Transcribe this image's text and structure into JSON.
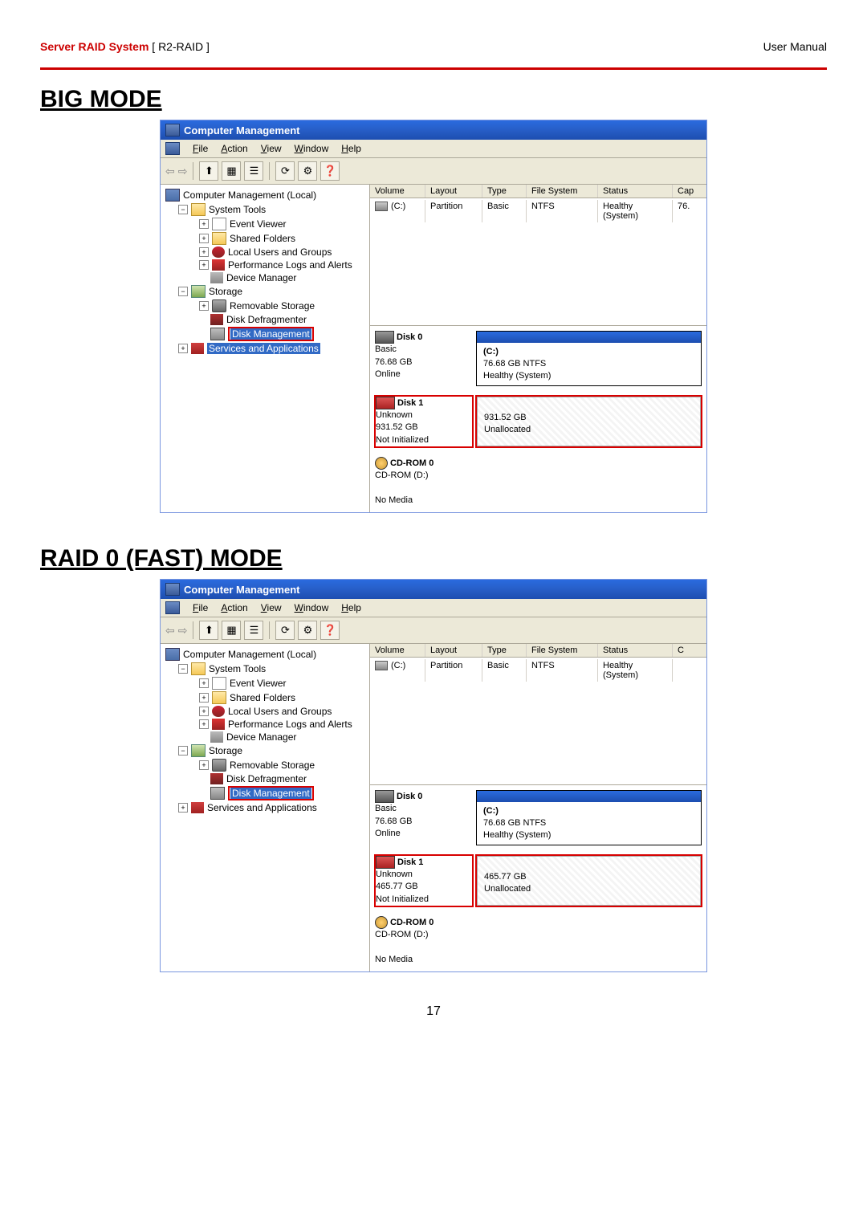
{
  "header": {
    "product": "Server RAID System",
    "model": "[ R2-RAID ]",
    "right": "User Manual"
  },
  "page_number": "17",
  "sections": {
    "big": {
      "title": "BIG MODE"
    },
    "raid0": {
      "title": "RAID 0 (FAST) MODE"
    }
  },
  "cm": {
    "title": "Computer Management",
    "menus": {
      "file": "File",
      "action": "Action",
      "view": "View",
      "window": "Window",
      "help": "Help"
    },
    "tree": {
      "root": "Computer Management (Local)",
      "system_tools": "System Tools",
      "event_viewer": "Event Viewer",
      "shared_folders": "Shared Folders",
      "local_users": "Local Users and Groups",
      "perf_logs": "Performance Logs and Alerts",
      "device_manager": "Device Manager",
      "storage": "Storage",
      "removable_storage": "Removable Storage",
      "disk_defrag": "Disk Defragmenter",
      "disk_mgmt": "Disk Management",
      "services_apps": "Services and Applications"
    },
    "vol_headers": {
      "volume": "Volume",
      "layout": "Layout",
      "type": "Type",
      "fs": "File System",
      "status": "Status",
      "cap": "Cap"
    },
    "vol_headers2_cap": "C",
    "vol_row": {
      "volume": "(C:)",
      "layout": "Partition",
      "type": "Basic",
      "fs": "NTFS",
      "status": "Healthy (System)",
      "cap": "76.",
      "cap2": ""
    }
  },
  "big_disks": {
    "d0": {
      "title": "Disk 0",
      "l1": "Basic",
      "l2": "76.68 GB",
      "l3": "Online",
      "p_title": "(C:)",
      "p_l1": "76.68 GB NTFS",
      "p_l2": "Healthy (System)"
    },
    "d1": {
      "title": "Disk 1",
      "l1": "Unknown",
      "l2": "931.52 GB",
      "l3": "Not Initialized",
      "p_l1": "931.52 GB",
      "p_l2": "Unallocated"
    },
    "cd": {
      "title": "CD-ROM 0",
      "l1": "CD-ROM (D:)",
      "l2": "",
      "l3": "No Media"
    }
  },
  "raid0_disks": {
    "d0": {
      "title": "Disk 0",
      "l1": "Basic",
      "l2": "76.68 GB",
      "l3": "Online",
      "p_title": "(C:)",
      "p_l1": "76.68 GB NTFS",
      "p_l2": "Healthy (System)"
    },
    "d1": {
      "title": "Disk 1",
      "l1": "Unknown",
      "l2": "465.77 GB",
      "l3": "Not Initialized",
      "p_l1": "465.77 GB",
      "p_l2": "Unallocated"
    },
    "cd": {
      "title": "CD-ROM 0",
      "l1": "CD-ROM (D:)",
      "l2": "",
      "l3": "No Media"
    }
  }
}
